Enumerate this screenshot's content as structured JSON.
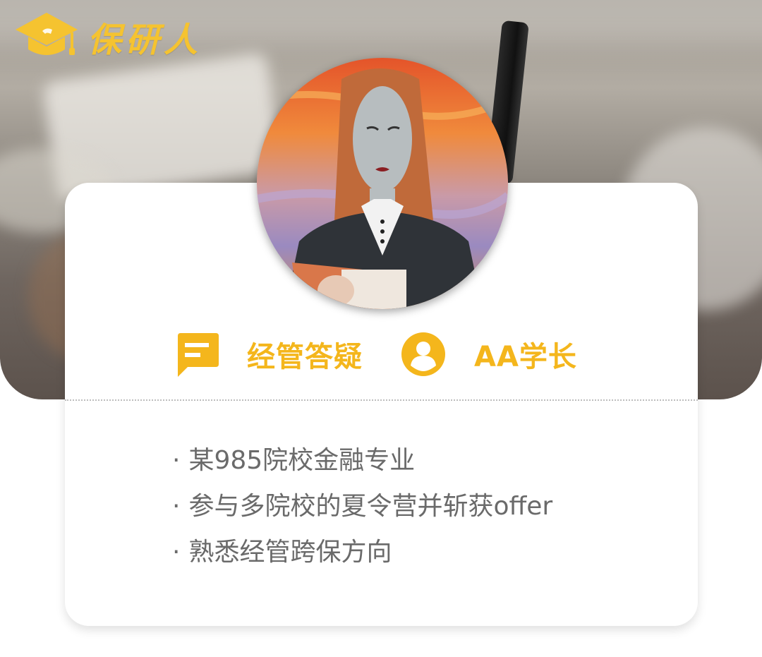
{
  "brand": {
    "name": "保研人",
    "color": "#f5c330",
    "icon": "graduation-cap-icon"
  },
  "profile": {
    "topic_icon": "chat-bubble-icon",
    "topic": "经管答疑",
    "mentor_icon": "user-icon",
    "mentor": "AA学长",
    "accent_color": "#f4b61c"
  },
  "bullets": [
    "某985院校金融专业",
    "参与多院校的夏令营并斩获offer",
    "熟悉经管跨保方向"
  ],
  "bullet_marker": "·"
}
